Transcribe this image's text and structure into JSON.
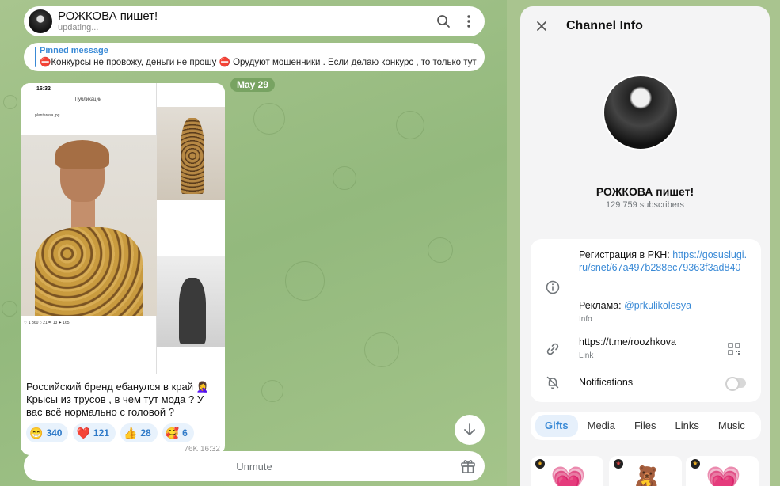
{
  "chat": {
    "title": "РОЖКОВА пишет!",
    "status": "updating...",
    "pinned_label": "Pinned message",
    "pinned_text": "⛔️Конкурсы не провожу, деньги не прошу ⛔️ Орудуют мошенники . Если делаю конкурс , то только тут ...",
    "date_badge": "May 29",
    "message": {
      "phone_time": "16:32",
      "phone_title": "Публикации",
      "phone_user": "plantarosa.jpg",
      "phone_stats": "♡ 1 360  ○ 21  ⇆ 13  ➤ 165",
      "text": "Российский бренд ебанулся в край 🤦‍♀️ Крысы из трусов , в чем тут мода ? У вас всё нормально с головой ?",
      "reactions": [
        {
          "emoji": "😁",
          "count": "340"
        },
        {
          "emoji": "❤️",
          "count": "121"
        },
        {
          "emoji": "👍",
          "count": "28"
        },
        {
          "emoji": "🥰",
          "count": "6"
        }
      ],
      "meta": "76K  16:32"
    },
    "unmute_label": "Unmute"
  },
  "panel": {
    "title": "Channel Info",
    "channel_name": "РОЖКОВА пишет!",
    "subscribers": "129 759 subscribers",
    "info": {
      "desc_prefix": "Регистрация в РКН: ",
      "desc_link": "https://gosuslugi.ru/snet/67a497b288ec79363f3ad840",
      "ads_prefix": "Реклама: ",
      "ads_link": "@prkulikolesya",
      "info_label": "Info",
      "link": "https://t.me/roozhkova",
      "link_label": "Link",
      "notifications": "Notifications"
    },
    "tabs": [
      {
        "label": "Gifts"
      },
      {
        "label": "Media"
      },
      {
        "label": "Files"
      },
      {
        "label": "Links"
      },
      {
        "label": "Music"
      }
    ],
    "gifts": [
      "💗",
      "🧸",
      "💗"
    ]
  },
  "colors": {
    "accent": "#3a8ad6",
    "chat_bg": "#a9c48f"
  }
}
